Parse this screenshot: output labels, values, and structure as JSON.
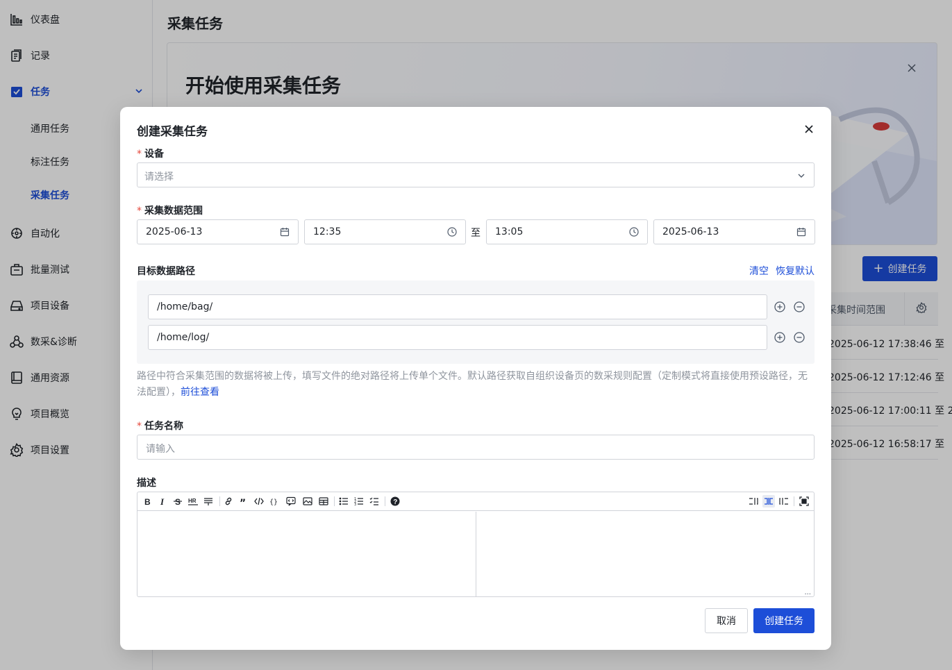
{
  "sidebar": {
    "items": [
      {
        "label": "仪表盘",
        "icon": "bar-chart-icon"
      },
      {
        "label": "记录",
        "icon": "document-icon"
      },
      {
        "label": "任务",
        "icon": "task-icon"
      },
      {
        "label": "自动化",
        "icon": "automation-icon"
      },
      {
        "label": "批量测试",
        "icon": "batch-test-icon"
      },
      {
        "label": "项目设备",
        "icon": "device-icon"
      },
      {
        "label": "数采&诊断",
        "icon": "diagnosis-icon"
      },
      {
        "label": "通用资源",
        "icon": "resource-icon"
      },
      {
        "label": "项目概览",
        "icon": "overview-icon"
      },
      {
        "label": "项目设置",
        "icon": "gear-icon"
      }
    ],
    "task_subitems": [
      "通用任务",
      "标注任务",
      "采集任务"
    ],
    "active_subitem": "采集任务"
  },
  "page": {
    "title": "采集任务",
    "banner_title": "开始使用采集任务",
    "create_button": "创建任务",
    "table": {
      "column_header": "采集时间范围",
      "rows": [
        "2025-06-12 17:38:46 至",
        "2025-06-12 17:12:46 至",
        "2025-06-12 17:00:11 至 2",
        "2025-06-12 16:58:17 至"
      ]
    }
  },
  "modal": {
    "title": "创建采集任务",
    "device": {
      "label": "设备",
      "placeholder": "请选择"
    },
    "range": {
      "label": "采集数据范围",
      "start_date": "2025-06-13",
      "start_time": "12:35",
      "separator": "至",
      "end_time": "13:05",
      "end_date": "2025-06-13"
    },
    "paths": {
      "label": "目标数据路径",
      "clear_link": "清空",
      "reset_link": "恢复默认",
      "values": [
        "/home/bag/",
        "/home/log/"
      ]
    },
    "hint_text": "路径中符合采集范围的数据将被上传，填写文件的绝对路径将上传单个文件。默认路径获取自组织设备页的数采规则配置（定制模式将直接使用预设路径，无法配置），",
    "hint_link": "前往查看",
    "task_name": {
      "label": "任务名称",
      "placeholder": "请输入"
    },
    "description": {
      "label": "描述",
      "resize_handle": "..."
    },
    "cancel_button": "取消",
    "submit_button": "创建任务"
  },
  "colors": {
    "accent": "#1d4ed8",
    "required": "#e5483c",
    "overlay": "rgba(0,0,0,0.25)"
  }
}
